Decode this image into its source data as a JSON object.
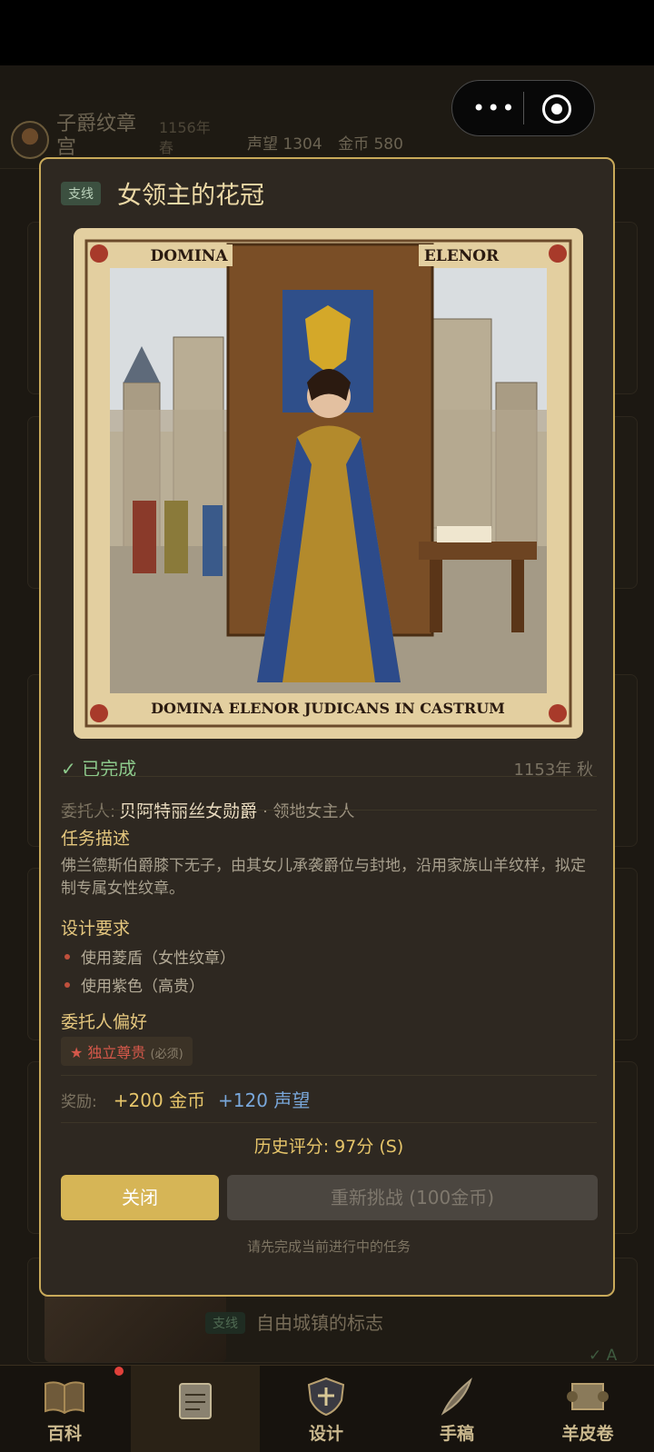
{
  "header": {
    "title": "子爵纹章宫",
    "year": "1156年 春",
    "reputation": "声望 1304",
    "gold": "金币 580"
  },
  "modal": {
    "tag": "支线",
    "title": "女领主的花冠",
    "illustration_banner_left": "DOMINA",
    "illustration_banner_right": "ELENOR",
    "illustration_caption": "DOMINA ELENOR JUDICANS IN CASTRUM",
    "status": "已完成",
    "date": "1153年 秋",
    "client_label": "委托人:",
    "client_name": "贝阿特丽丝女勋爵",
    "client_role": "· 领地女主人",
    "desc_heading": "任务描述",
    "description": "佛兰德斯伯爵膝下无子，由其女儿承袭爵位与封地，沿用家族山羊纹样，拟定制专属女性纹章。",
    "req_heading": "设计要求",
    "requirements": [
      "使用菱盾（女性纹章）",
      "使用紫色（高贵）"
    ],
    "pref_heading": "委托人偏好",
    "preference": "★ 独立尊贵",
    "preference_tag": "(必须)",
    "reward_label": "奖励:",
    "reward_gold": "+200 金币",
    "reward_fame": "+120 声望",
    "score": "历史评分: 97分 (S)",
    "close_button": "关闭",
    "retry_button": "重新挑战 (100金币)",
    "hint": "请先完成当前进行中的任务"
  },
  "background_list": {
    "last_item_tag": "支线",
    "last_item_title": "自由城镇的标志",
    "last_item_grade": "✓ A"
  },
  "nav": {
    "items": [
      {
        "label": "百科",
        "icon": "book-icon"
      },
      {
        "label": "",
        "icon": "clipboard-icon"
      },
      {
        "label": "设计",
        "icon": "shield-icon"
      },
      {
        "label": "手稿",
        "icon": "quill-icon"
      },
      {
        "label": "羊皮卷",
        "icon": "scroll-icon"
      }
    ]
  },
  "colors": {
    "accent_gold": "#d6b556",
    "modal_border": "#c9aa5a",
    "success": "#8cc98b",
    "fame_blue": "#79a7da",
    "warning_red": "#d4584a"
  }
}
